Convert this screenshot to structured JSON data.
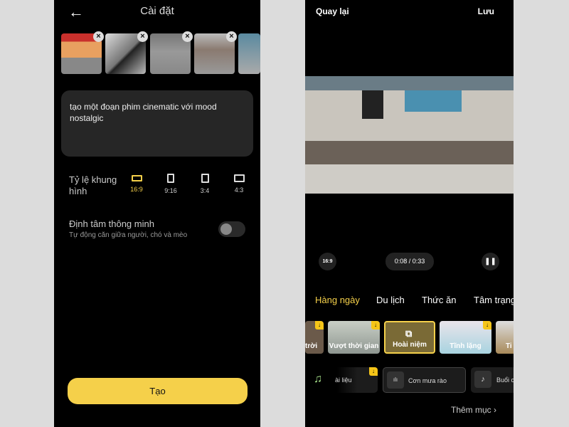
{
  "left": {
    "title": "Cài đặt",
    "prompt": "tạo một đoạn phim cinematic với mood nostalgic",
    "aspect_label": "Tỷ lệ khung hình",
    "ratios": [
      {
        "label": "16:9",
        "selected": true
      },
      {
        "label": "9:16",
        "selected": false
      },
      {
        "label": "3:4",
        "selected": false
      },
      {
        "label": "4:3",
        "selected": false
      }
    ],
    "smart_center": {
      "title": "Định tâm thông minh",
      "subtitle": "Tự động căn giữa người, chó và mèo",
      "enabled": false
    },
    "create_label": "Tạo",
    "accent": "#f5d04a"
  },
  "right": {
    "back_label": "Quay lại",
    "save_label": "Lưu",
    "ratio_badge": "16:9",
    "time": "0:08 / 0:33",
    "tabs": [
      {
        "label": "Hàng ngày",
        "active": true
      },
      {
        "label": "Du lịch"
      },
      {
        "label": "Thức ăn"
      },
      {
        "label": "Tâm trạng"
      }
    ],
    "styles": [
      {
        "label": "trời"
      },
      {
        "label": "Vượt thời gian"
      },
      {
        "label": "Hoài niệm",
        "selected": true
      },
      {
        "label": "Tĩnh lặng"
      },
      {
        "label": "Ti"
      }
    ],
    "music": [
      {
        "label": "ài liệu"
      },
      {
        "label": "Cơn mưa rào"
      },
      {
        "label": "Buổi c"
      }
    ],
    "more_label": "Thêm mục"
  }
}
